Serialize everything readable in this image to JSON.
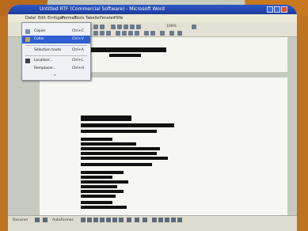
{
  "window": {
    "title": "Untitled RTF (Commercial Software) - Microsoft Word"
  },
  "menubar": {
    "items": [
      "Datei",
      "Edit",
      "Einfügen",
      "Format",
      "Tools",
      "Tabelle",
      "Fenster",
      "Hilfe"
    ]
  },
  "toolbar": {
    "zoom": "100%"
  },
  "edit_menu": {
    "items": [
      {
        "label": "Copier",
        "shortcut": "Ctrl+C",
        "selected": false
      },
      {
        "label": "Coller",
        "shortcut": "Ctrl+V",
        "selected": true
      },
      {
        "label": "Sélection toute",
        "shortcut": "Ctrl+A",
        "selected": false
      },
      {
        "label": "Localiser...",
        "shortcut": "Ctrl+L",
        "selected": false
      },
      {
        "label": "Remplacer...",
        "shortcut": "Ctrl+H",
        "selected": false
      }
    ],
    "more": "»"
  },
  "statusbar": {
    "drawing_label": "Dessiner",
    "autoshapes_label": "AutoFormes"
  },
  "colors": {
    "titlebar": "#1c3a99",
    "menu_highlight": "#2f5fd0",
    "frame": "#bd7322"
  }
}
